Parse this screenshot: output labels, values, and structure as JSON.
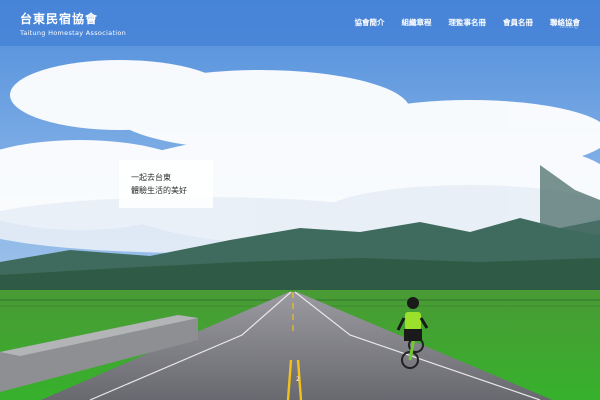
{
  "brand": {
    "title": "台東民宿協會",
    "subtitle": "Taitung Homestay Association"
  },
  "nav": {
    "items": [
      {
        "label": "協會簡介"
      },
      {
        "label": "組織章程"
      },
      {
        "label": "理監事名冊"
      },
      {
        "label": "會員名冊"
      },
      {
        "label": "聯絡協會"
      }
    ]
  },
  "hero": {
    "line1": "一起去台東",
    "line2": "體驗生活的美好"
  },
  "slider": {
    "indicator": "2"
  },
  "colors": {
    "header": "#4682d7",
    "sky": "#6aa0dc",
    "field": "#3fae2a",
    "road": "#6f6f73",
    "road_line": "#f2c21a"
  }
}
